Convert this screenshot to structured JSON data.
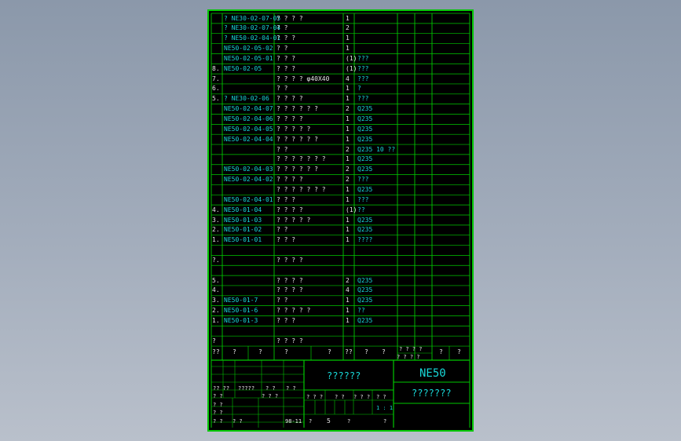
{
  "bom": {
    "rows": [
      {
        "seq": "",
        "code": "? NE30-02-07-05",
        "name": "? ? ? ?",
        "qty": "1",
        "material": ""
      },
      {
        "seq": "",
        "code": "? NE30-02-07-04",
        "name": "? ?",
        "qty": "2",
        "material": ""
      },
      {
        "seq": "",
        "code": "? NE50-02-04-01",
        "name": "? ? ?",
        "qty": "1",
        "material": ""
      },
      {
        "seq": "",
        "code": "NE50-02-05-02",
        "name": "? ?",
        "qty": "1",
        "material": ""
      },
      {
        "seq": "",
        "code": "NE50-02-05-01",
        "name": "? ? ?",
        "qty": "(1)",
        "material": "???"
      },
      {
        "seq": "8.",
        "code": "NE50-02-05",
        "name": "? ? ?",
        "qty": "(1)",
        "material": "???"
      },
      {
        "seq": "7.",
        "code": "",
        "name": "? ? ? ?   φ40X40",
        "qty": "4",
        "material": "???"
      },
      {
        "seq": "6.",
        "code": "",
        "name": "? ?",
        "qty": "1",
        "material": "?"
      },
      {
        "seq": "5.",
        "code": "? NE30-02-06",
        "name": "? ? ? ?",
        "qty": "1",
        "material": "???"
      },
      {
        "seq": "",
        "code": "NE50-02-04-07",
        "name": "? ? ? ? ? ?",
        "qty": "2",
        "material": "Q235"
      },
      {
        "seq": "",
        "code": "NE50-02-04-06",
        "name": "? ? ? ?",
        "qty": "1",
        "material": "Q235"
      },
      {
        "seq": "",
        "code": "NE50-02-04-05",
        "name": "? ? ? ? ?",
        "qty": "1",
        "material": "Q235"
      },
      {
        "seq": "",
        "code": "NE50-02-04-04",
        "name": "? ? ? ? ? ?",
        "qty": "1",
        "material": "Q235"
      },
      {
        "seq": "",
        "code": "",
        "name": "?     ?",
        "qty": "2",
        "material": "Q235  10 ??"
      },
      {
        "seq": "",
        "code": "",
        "name": "? ? ? ? ? ? ?",
        "qty": "1",
        "material": "Q235"
      },
      {
        "seq": "",
        "code": "NE50-02-04-03",
        "name": "? ? ? ? ? ?",
        "qty": "2",
        "material": "Q235"
      },
      {
        "seq": "",
        "code": "NE50-02-04-02",
        "name": "? ? ? ?",
        "qty": "2",
        "material": "???"
      },
      {
        "seq": "",
        "code": "",
        "name": "? ? ? ? ? ? ?",
        "qty": "1",
        "material": "Q235"
      },
      {
        "seq": "",
        "code": "NE50-02-04-01",
        "name": "? ? ?",
        "qty": "1",
        "material": "???"
      },
      {
        "seq": "4.",
        "code": "NE50-01-04",
        "name": "? ? ? ?",
        "qty": "(1)",
        "material": "??"
      },
      {
        "seq": "3.",
        "code": "NE50-01-03",
        "name": "? ? ? ? ?",
        "qty": "1",
        "material": "Q235"
      },
      {
        "seq": "2.",
        "code": "NE50-01-02",
        "name": "? ?",
        "qty": "1",
        "material": "Q235"
      },
      {
        "seq": "1.",
        "code": "NE50-01-01",
        "name": "? ? ?",
        "qty": "1",
        "material": "????"
      },
      {
        "seq": "",
        "code": "",
        "name": "",
        "qty": "",
        "material": ""
      },
      {
        "seq": "?.",
        "code": "",
        "name": "  ? ? ? ?",
        "qty": "",
        "material": ""
      },
      {
        "seq": "",
        "code": "",
        "name": "",
        "qty": "",
        "material": ""
      },
      {
        "seq": "5.",
        "code": "",
        "name": "  ? ? ? ?",
        "qty": "2",
        "material": "Q235"
      },
      {
        "seq": "4.",
        "code": "",
        "name": "  ? ? ? ?",
        "qty": "4",
        "material": "Q235"
      },
      {
        "seq": "3.",
        "code": "NE50-01-7",
        "name": "? ?",
        "qty": "1",
        "material": "Q235"
      },
      {
        "seq": "2.",
        "code": "NE50-01-6",
        "name": "? ? ? ? ?",
        "qty": "1",
        "material": "??"
      },
      {
        "seq": "1.",
        "code": "NE50-01-3",
        "name": "? ? ?",
        "qty": "1",
        "material": "Q235"
      },
      {
        "seq": "",
        "code": "",
        "name": "",
        "qty": "",
        "material": ""
      },
      {
        "seq": "?",
        "code": "",
        "name": "  ? ? ? ?",
        "qty": "",
        "material": ""
      }
    ],
    "header": {
      "c1": "??",
      "c2": "?",
      "c3": "?",
      "c4": "?",
      "c5": "?",
      "c6": "??",
      "c7": "?",
      "c8": "?",
      "c9": "? ? ? ?",
      "c10": "?",
      "c11": "?"
    }
  },
  "title_block": {
    "drawing_number": "NE50",
    "part_name": "??????",
    "drawing_title": "???????",
    "scale": "1 : 1",
    "sheet_count": "5",
    "year": "98-11",
    "grid_labels": [
      "?? ??",
      "?????",
      "? ?",
      "? ?",
      "? ? ?",
      "? ?",
      "? ? ?",
      "? ?",
      "? ? ?",
      "? ?",
      "?",
      "? ?",
      "? ?"
    ],
    "sign_labels": [
      "?  ?",
      "?  ?",
      "?  ?",
      "?  ?"
    ],
    "right_labels": [
      "? ? ? ?",
      "? ? ?",
      "? ?",
      "?",
      "?",
      "?",
      "?",
      "?"
    ]
  },
  "colors": {
    "frame": "#00c800",
    "text": "#e6e6e6",
    "code": "#18d8d8",
    "background": "#000000"
  }
}
